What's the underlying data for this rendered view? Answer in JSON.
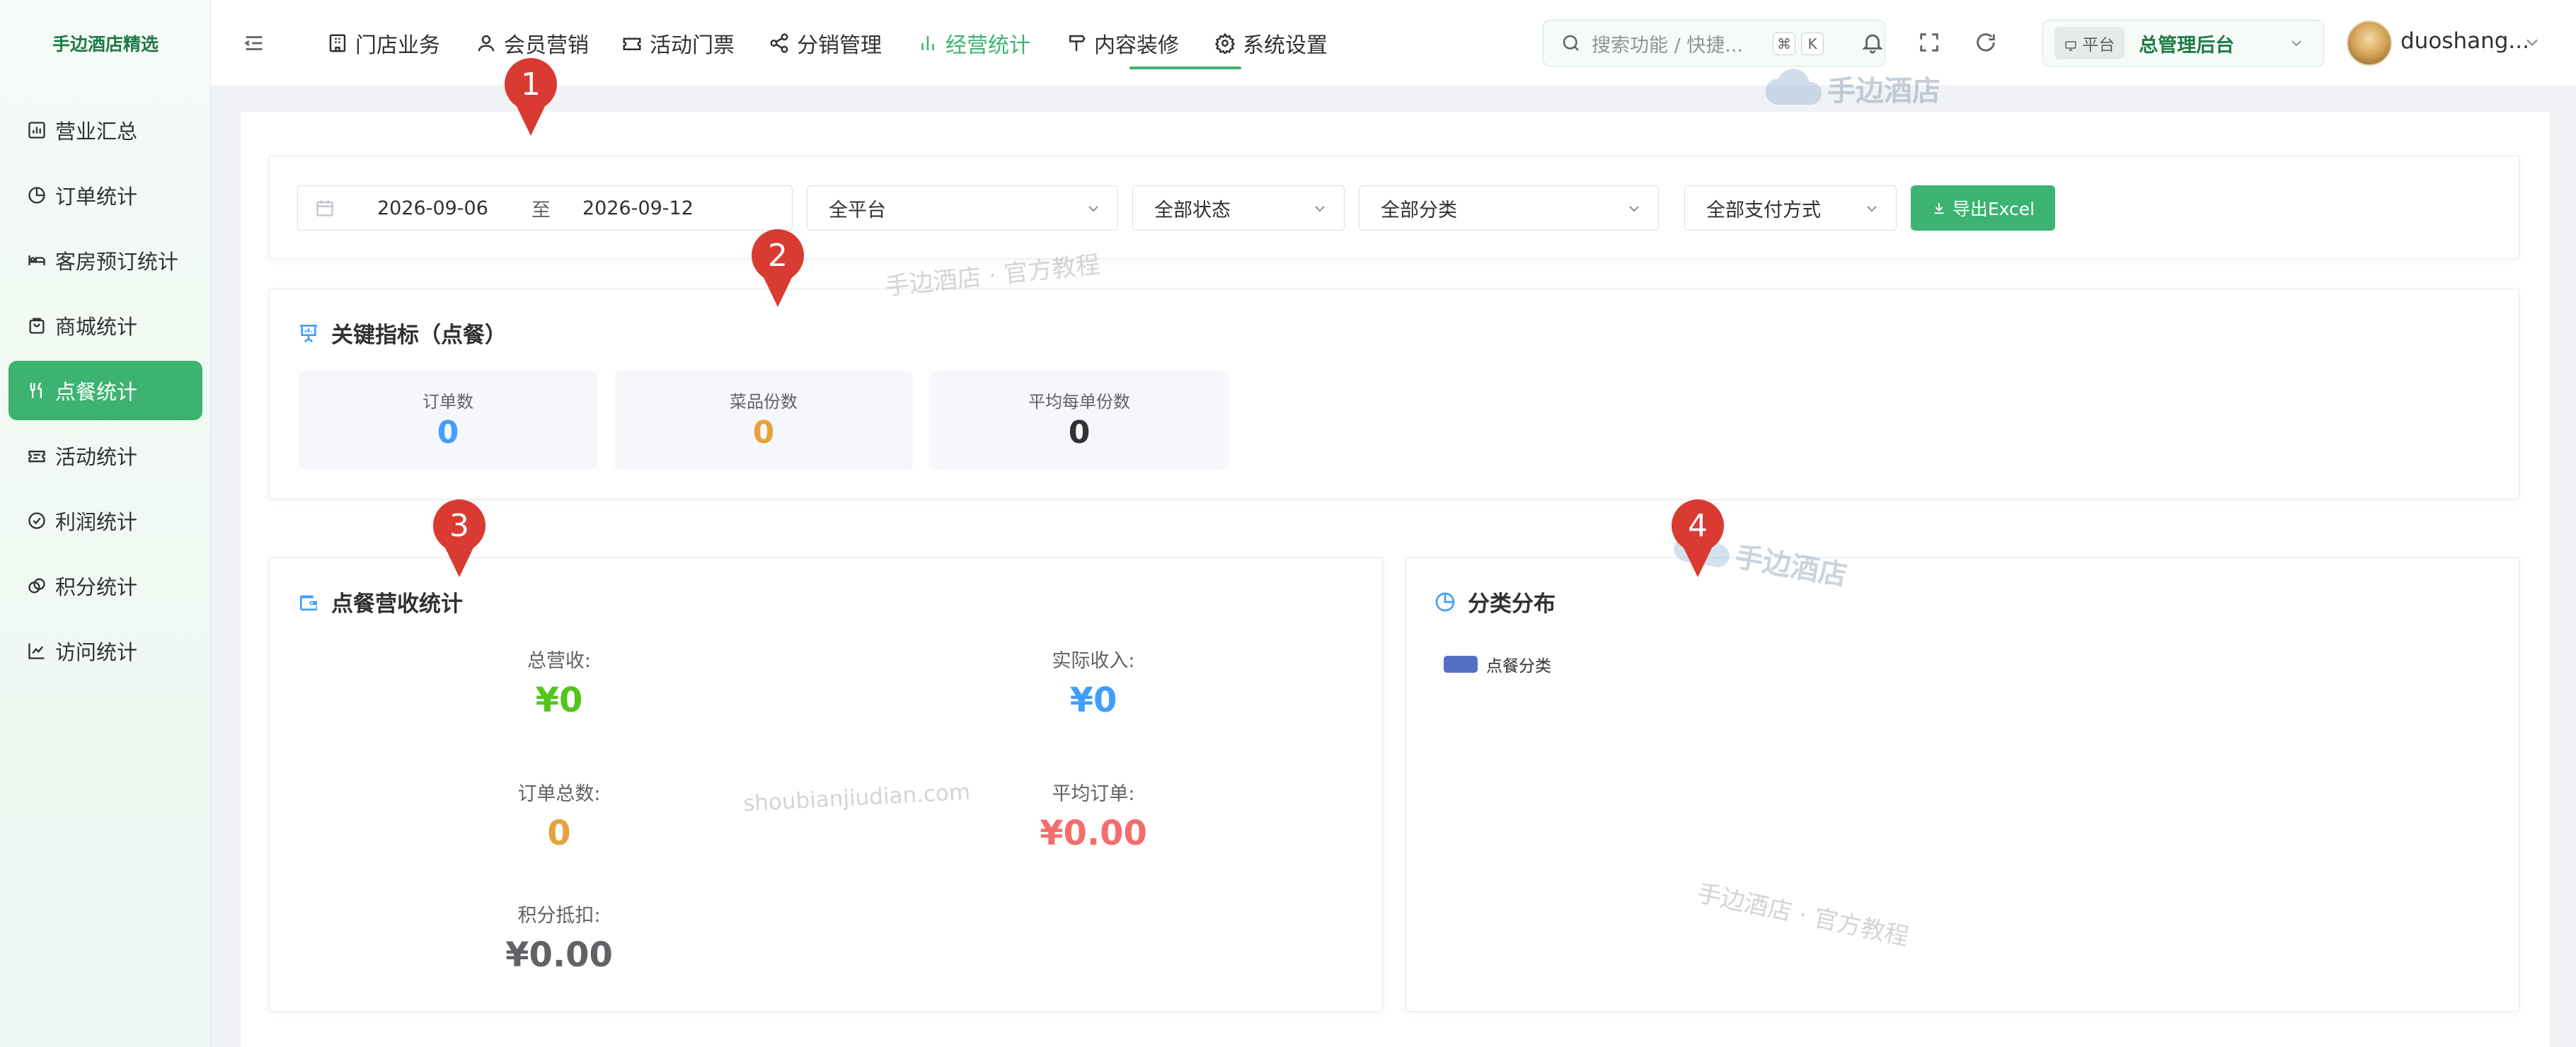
{
  "app": {
    "brand": "手边酒店精选"
  },
  "sidebar": {
    "items": [
      {
        "label": "营业汇总",
        "icon": "bar-chart-icon"
      },
      {
        "label": "订单统计",
        "icon": "pie-icon"
      },
      {
        "label": "客房预订统计",
        "icon": "bed-icon"
      },
      {
        "label": "商城统计",
        "icon": "shopping-bag-icon"
      },
      {
        "label": "点餐统计",
        "icon": "utensils-icon",
        "active": true
      },
      {
        "label": "活动统计",
        "icon": "ticket-icon"
      },
      {
        "label": "利润统计",
        "icon": "check-circle-icon"
      },
      {
        "label": "积分统计",
        "icon": "coins-icon"
      },
      {
        "label": "访问统计",
        "icon": "line-chart-icon"
      }
    ]
  },
  "header": {
    "nav": [
      {
        "label": "门店业务",
        "icon": "building-icon"
      },
      {
        "label": "会员营销",
        "icon": "user-icon"
      },
      {
        "label": "活动门票",
        "icon": "ticket-icon"
      },
      {
        "label": "分销管理",
        "icon": "share-icon"
      },
      {
        "label": "经营统计",
        "icon": "bar-chart-icon",
        "active": true
      },
      {
        "label": "内容装修",
        "icon": "signpost-icon"
      },
      {
        "label": "系统设置",
        "icon": "gear-icon"
      }
    ],
    "search_placeholder": "搜索功能 / 快捷...",
    "search_keys": [
      "⌘",
      "K"
    ],
    "platform_tag": "平台",
    "platform_name": "总管理后台",
    "username": "duoshang..."
  },
  "filters": {
    "date_start": "2026-09-06",
    "date_sep": "至",
    "date_end": "2026-09-12",
    "platform": "全平台",
    "status": "全部状态",
    "category": "全部分类",
    "payment": "全部支付方式",
    "export_label": "导出Excel"
  },
  "key_metrics": {
    "title": "关键指标（点餐）",
    "items": [
      {
        "label": "订单数",
        "value": "0",
        "color": "#409eff"
      },
      {
        "label": "菜品份数",
        "value": "0",
        "color": "#e6a23c"
      },
      {
        "label": "平均每单份数",
        "value": "0",
        "color": "#303133"
      }
    ]
  },
  "revenue": {
    "title": "点餐营收统计",
    "total_revenue_label": "总营收:",
    "total_revenue": "¥0",
    "actual_income_label": "实际收入:",
    "actual_income": "¥0",
    "order_total_label": "订单总数:",
    "order_total": "0",
    "avg_order_label": "平均订单:",
    "avg_order": "¥0.00",
    "points_label": "积分抵扣:",
    "points": "¥0.00"
  },
  "category_dist": {
    "title": "分类分布",
    "legend": "点餐分类",
    "legend_color": "#5470c6"
  },
  "watermarks": {
    "brand1": "手边酒店",
    "tutorial1": "手边酒店 · 官方教程",
    "url": "shoubianjiudian.com",
    "brand2": "手边酒店",
    "tutorial2": "手边酒店 · 官方教程"
  },
  "markers": [
    "1",
    "2",
    "3",
    "4"
  ],
  "colors": {
    "accent": "#3cb371",
    "green_value": "#52c41a",
    "blue_value": "#409eff",
    "orange_value": "#e6a23c",
    "red_value": "#f56c6c"
  }
}
